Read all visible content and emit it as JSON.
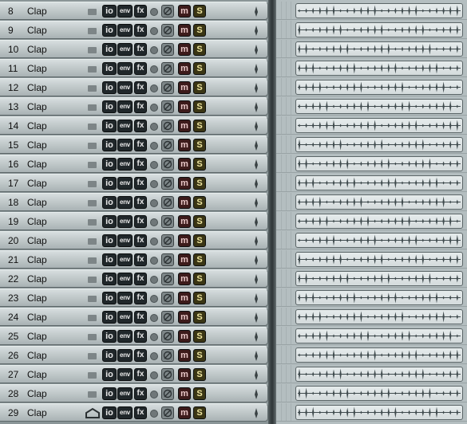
{
  "tracks": [
    {
      "number": "8",
      "name": "Clap"
    },
    {
      "number": "9",
      "name": "Clap"
    },
    {
      "number": "10",
      "name": "Clap"
    },
    {
      "number": "11",
      "name": "Clap"
    },
    {
      "number": "12",
      "name": "Clap"
    },
    {
      "number": "13",
      "name": "Clap"
    },
    {
      "number": "14",
      "name": "Clap"
    },
    {
      "number": "15",
      "name": "Clap"
    },
    {
      "number": "16",
      "name": "Clap"
    },
    {
      "number": "17",
      "name": "Clap"
    },
    {
      "number": "18",
      "name": "Clap"
    },
    {
      "number": "19",
      "name": "Clap"
    },
    {
      "number": "20",
      "name": "Clap"
    },
    {
      "number": "21",
      "name": "Clap"
    },
    {
      "number": "22",
      "name": "Clap"
    },
    {
      "number": "23",
      "name": "Clap"
    },
    {
      "number": "24",
      "name": "Clap"
    },
    {
      "number": "25",
      "name": "Clap"
    },
    {
      "number": "26",
      "name": "Clap"
    },
    {
      "number": "27",
      "name": "Clap"
    },
    {
      "number": "28",
      "name": "Clap"
    },
    {
      "number": "29",
      "name": "Clap"
    }
  ],
  "buttons": {
    "io": "io",
    "env": "env",
    "fx": "fx",
    "mute": "m",
    "solo": "S"
  },
  "colors": {
    "panel": "#c2cacb",
    "arrange_bg": "#b4bec0",
    "clip_bg": "#dfe5e6",
    "waveform": "#3f4a4d",
    "mute_button": "#3d1b1b",
    "solo_button": "#3a3514"
  }
}
